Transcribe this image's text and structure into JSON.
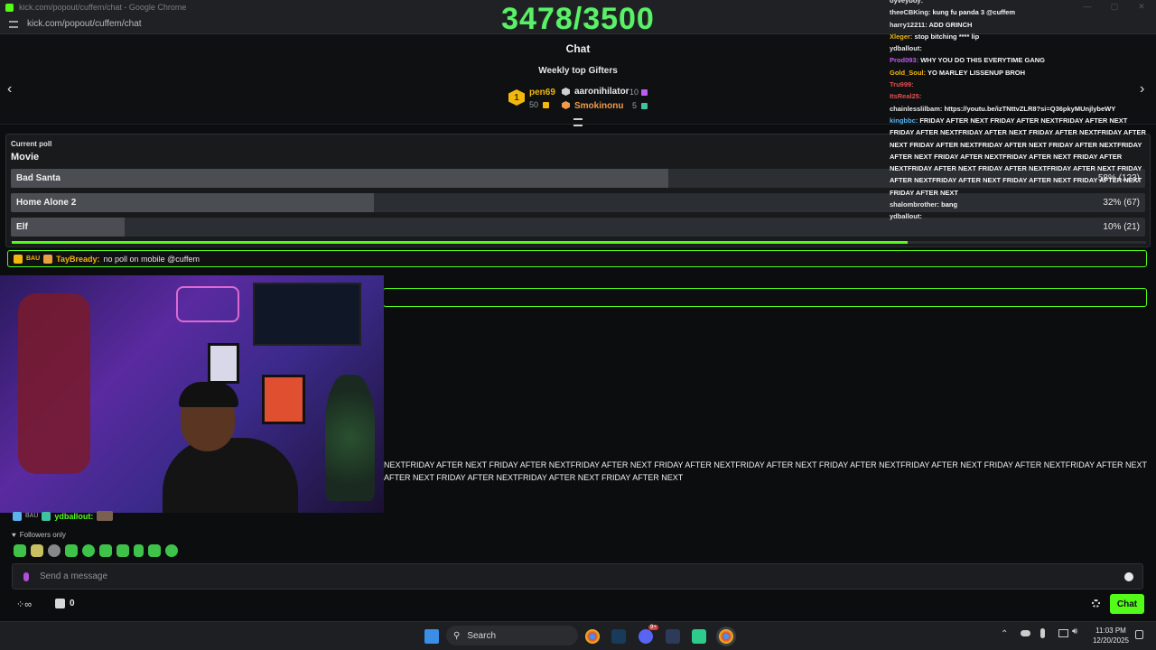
{
  "browser": {
    "window_title": "kick.com/popout/cuffem/chat - Google Chrome",
    "url": "kick.com/popout/cuffem/chat"
  },
  "overlay_counter": "3478/3500",
  "chat_header": {
    "title": "Chat",
    "gifters_title": "Weekly top Gifters",
    "gifters": [
      {
        "rank": "1",
        "name": "pen69",
        "count": "50",
        "name_color": "#f2b80e"
      },
      {
        "name": "aaronihilator",
        "count": "10",
        "name_color": "#e8e8e8"
      },
      {
        "name": "Smokinonu",
        "count": "5",
        "name_color": "#f29a4a"
      }
    ]
  },
  "poll": {
    "label": "Current poll",
    "question": "Movie",
    "options": [
      {
        "label": "Bad Santa",
        "pct_text": "58% (123)",
        "fraction": 0.58
      },
      {
        "label": "Home Alone 2",
        "pct_text": "32% (67)",
        "fraction": 0.32
      },
      {
        "label": "Elf",
        "pct_text": "10% (21)",
        "fraction": 0.1
      }
    ],
    "time_remaining_fraction": 0.79
  },
  "pinned_message": {
    "badge_text": "BAU",
    "user": "TayBready:",
    "text": "no poll on mobile @cuffem"
  },
  "chat_messages": [
    {
      "text": "NEXTFRIDAY AFTER NEXT FRIDAY AFTER NEXTFRIDAY AFTER NEXT FRIDAY AFTER NEXTFRIDAY AFTER NEXT FRIDAY AFTER NEXTFRIDAY AFTER NEXT FRIDAY AFTER NEXTFRIDAY AFTER NEXT FRIDAY"
    },
    {
      "text": "AFTER NEXT FRIDAY AFTER NEXTFRIDAY AFTER NEXT FRIDAY AFTER NEXT"
    }
  ],
  "last_message": {
    "badge_text": "BAU",
    "user": "ydballout:"
  },
  "overlay_chat": [
    {
      "user": "oyveyboy:",
      "text": "",
      "color": "#e8e8e8"
    },
    {
      "user": "theeCBKing:",
      "text": "kung fu panda 3 @cuffem",
      "color": "#e8e8e8"
    },
    {
      "user": "harry12211:",
      "text": "ADD GRINCH",
      "color": "#e8e8e8"
    },
    {
      "user": "Xleger:",
      "text": "stop bitching **** lip",
      "color": "#f2b80e"
    },
    {
      "user": "ydballout:",
      "text": "",
      "color": "#e8e8e8"
    },
    {
      "user": "Prod093:",
      "text": "WHY YOU DO THIS EVERYTIME GANG",
      "color": "#c05cf0"
    },
    {
      "user": "Gold_Soul:",
      "text": "YO MARLEY LISSENUP BROH",
      "color": "#f2b80e"
    },
    {
      "user": "Tru999:",
      "text": "",
      "color": "#e25050"
    },
    {
      "user": "ItsReal25:",
      "text": "",
      "color": "#e25050"
    },
    {
      "user": "chainlesslilbam:",
      "text": "https://youtu.be/izTNttvZLR8?si=Q36pkyMUnjlybeWY",
      "color": "#e8e8e8"
    },
    {
      "user": "kingbbc:",
      "text": "FRIDAY AFTER NEXT FRIDAY AFTER NEXTFRIDAY AFTER NEXT FRIDAY AFTER NEXTFRIDAY AFTER NEXT FRIDAY AFTER NEXTFRIDAY AFTER NEXT FRIDAY AFTER NEXTFRIDAY AFTER NEXT FRIDAY AFTER NEXTFRIDAY AFTER NEXT FRIDAY AFTER NEXTFRIDAY AFTER NEXT FRIDAY AFTER NEXTFRIDAY AFTER NEXT FRIDAY AFTER NEXTFRIDAY AFTER NEXT FRIDAY AFTER NEXTFRIDAY AFTER NEXT FRIDAY AFTER NEXT FRIDAY AFTER NEXT FRIDAY AFTER NEXT",
      "color": "#5cb3f0"
    },
    {
      "user": "shalombrother:",
      "text": "bang",
      "color": "#e8e8e8"
    },
    {
      "user": "ydballout:",
      "text": "",
      "color": "#e8e8e8"
    }
  ],
  "footer": {
    "followers_label": "Followers only",
    "input_placeholder": "Send a message",
    "points": "0",
    "chat_button": "Chat"
  },
  "taskbar": {
    "search_label": "Search",
    "time": "11:03 PM",
    "date": "12/20/2025",
    "discord_badge": "9+"
  },
  "colors": {
    "accent": "#53fc18",
    "counter": "#5cf06a"
  }
}
